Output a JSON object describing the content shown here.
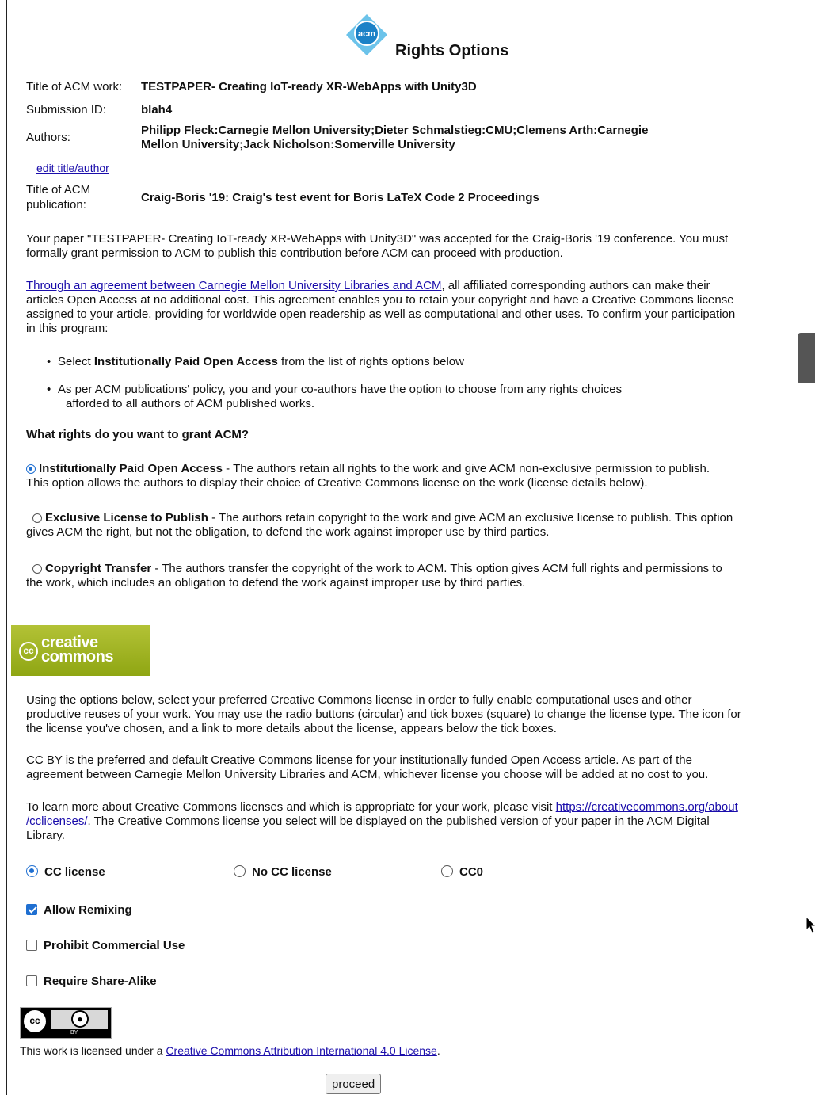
{
  "header": {
    "title": "Rights Options",
    "logo_text": "acm"
  },
  "info": {
    "work_label": "Title of ACM work:",
    "work_value": "TESTPAPER- Creating IoT-ready XR-WebApps with Unity3D",
    "submission_label": "Submission ID:",
    "submission_value": "blah4",
    "authors_label": "Authors:",
    "authors_line1": "Philipp Fleck:Carnegie Mellon University;Dieter Schmalstieg:CMU;Clemens Arth:Carnegie",
    "authors_line2": "Mellon University;Jack Nicholson:Somerville University",
    "edit_link": "edit title/author",
    "pub_label_line1": "Title of ACM",
    "pub_label_line2": "publication:",
    "pub_value": "Craig-Boris '19: Craig's test event for Boris LaTeX Code 2 Proceedings"
  },
  "intro": {
    "line1": "Your paper \"TESTPAPER- Creating IoT-ready XR-WebApps with Unity3D\" was accepted for the Craig-Boris '19 conference. You must",
    "line2": "formally grant permission to ACM to publish this contribution before ACM can proceed with production."
  },
  "agreement": {
    "link": "Through an agreement between Carnegie Mellon University Libraries and ACM",
    "line1_rest": ", all affiliated corresponding authors can make their",
    "line2": "articles Open Access at no additional cost. This agreement enables you to retain your copyright and have a Creative Commons license",
    "line3": "assigned to your article, providing for worldwide open readership as well as computational and other uses. To confirm your participation",
    "line4": "in this program:"
  },
  "bullets": {
    "b1_pre": "Select ",
    "b1_bold": "Institutionally Paid Open Access",
    "b1_post": " from the list of rights options below",
    "b2_line1": "As per ACM publications' policy, you and your co-authors have the option to choose from any rights choices",
    "b2_line2": "afforded to all authors of ACM published works."
  },
  "question": "What rights do you want to grant ACM?",
  "rights": [
    {
      "name": "Institutionally Paid Open Access",
      "line1": " - The authors retain all rights to the work and give ACM non-exclusive permission to publish.",
      "line2": "This option allows the authors to display their choice of Creative Commons license on the work (license details below).",
      "selected": true
    },
    {
      "name": "Exclusive License to Publish",
      "line1": " - The authors retain copyright to the work and give ACM an exclusive license to publish. This option",
      "line2": "gives ACM the right, but not the obligation, to defend the work against improper use by third parties.",
      "selected": false
    },
    {
      "name": "Copyright Transfer",
      "line1": " - The authors transfer the copyright of the work to ACM. This option gives ACM full rights and permissions to",
      "line2": "the work, which includes an obligation to defend the work against improper use by third parties.",
      "selected": false
    }
  ],
  "cc_logo": {
    "symbol": "cc",
    "line1": "creative",
    "line2": "commons"
  },
  "cc_text": {
    "p1_line1": "Using the options below, select your preferred Creative Commons license in order to fully enable computational uses and other",
    "p1_line2": "productive reuses of your work. You may use the radio buttons (circular) and tick boxes (square) to change the license type. The icon for",
    "p1_line3": "the license you've chosen, and a link to more details about the license, appears below the tick boxes.",
    "p2_line1": "CC BY is the preferred and default Creative Commons license for your institutionally funded Open Access article. As part of the",
    "p2_line2": "agreement between Carnegie Mellon University Libraries and ACM, whichever license you choose will be added at no cost to you.",
    "p3_pre": "To learn more about Creative Commons licenses and which is appropriate for your work, please visit ",
    "p3_link1": "https://creativecommons.org/about",
    "p3_link2": "/cclicenses/",
    "p3_line2_rest": ". The Creative Commons license you select will be displayed on the published version of your paper in the ACM Digital",
    "p3_line3": "Library."
  },
  "license_type": [
    {
      "label": "CC license",
      "selected": true
    },
    {
      "label": "No CC license",
      "selected": false
    },
    {
      "label": "CC0",
      "selected": false
    }
  ],
  "options": [
    {
      "label": "Allow Remixing",
      "checked": true
    },
    {
      "label": "Prohibit Commercial Use",
      "checked": false
    },
    {
      "label": "Require Share-Alike",
      "checked": false
    }
  ],
  "badge": {
    "cc": "cc",
    "by": "BY"
  },
  "license_notice": {
    "pre": "This work is licensed under a ",
    "link": "Creative Commons Attribution International 4.0 License",
    "post": "."
  },
  "proceed_label": "proceed",
  "colors": {
    "link": "#1a0dab",
    "radio_selected": "#1f6fd1",
    "cc_green": "#aab81f"
  }
}
